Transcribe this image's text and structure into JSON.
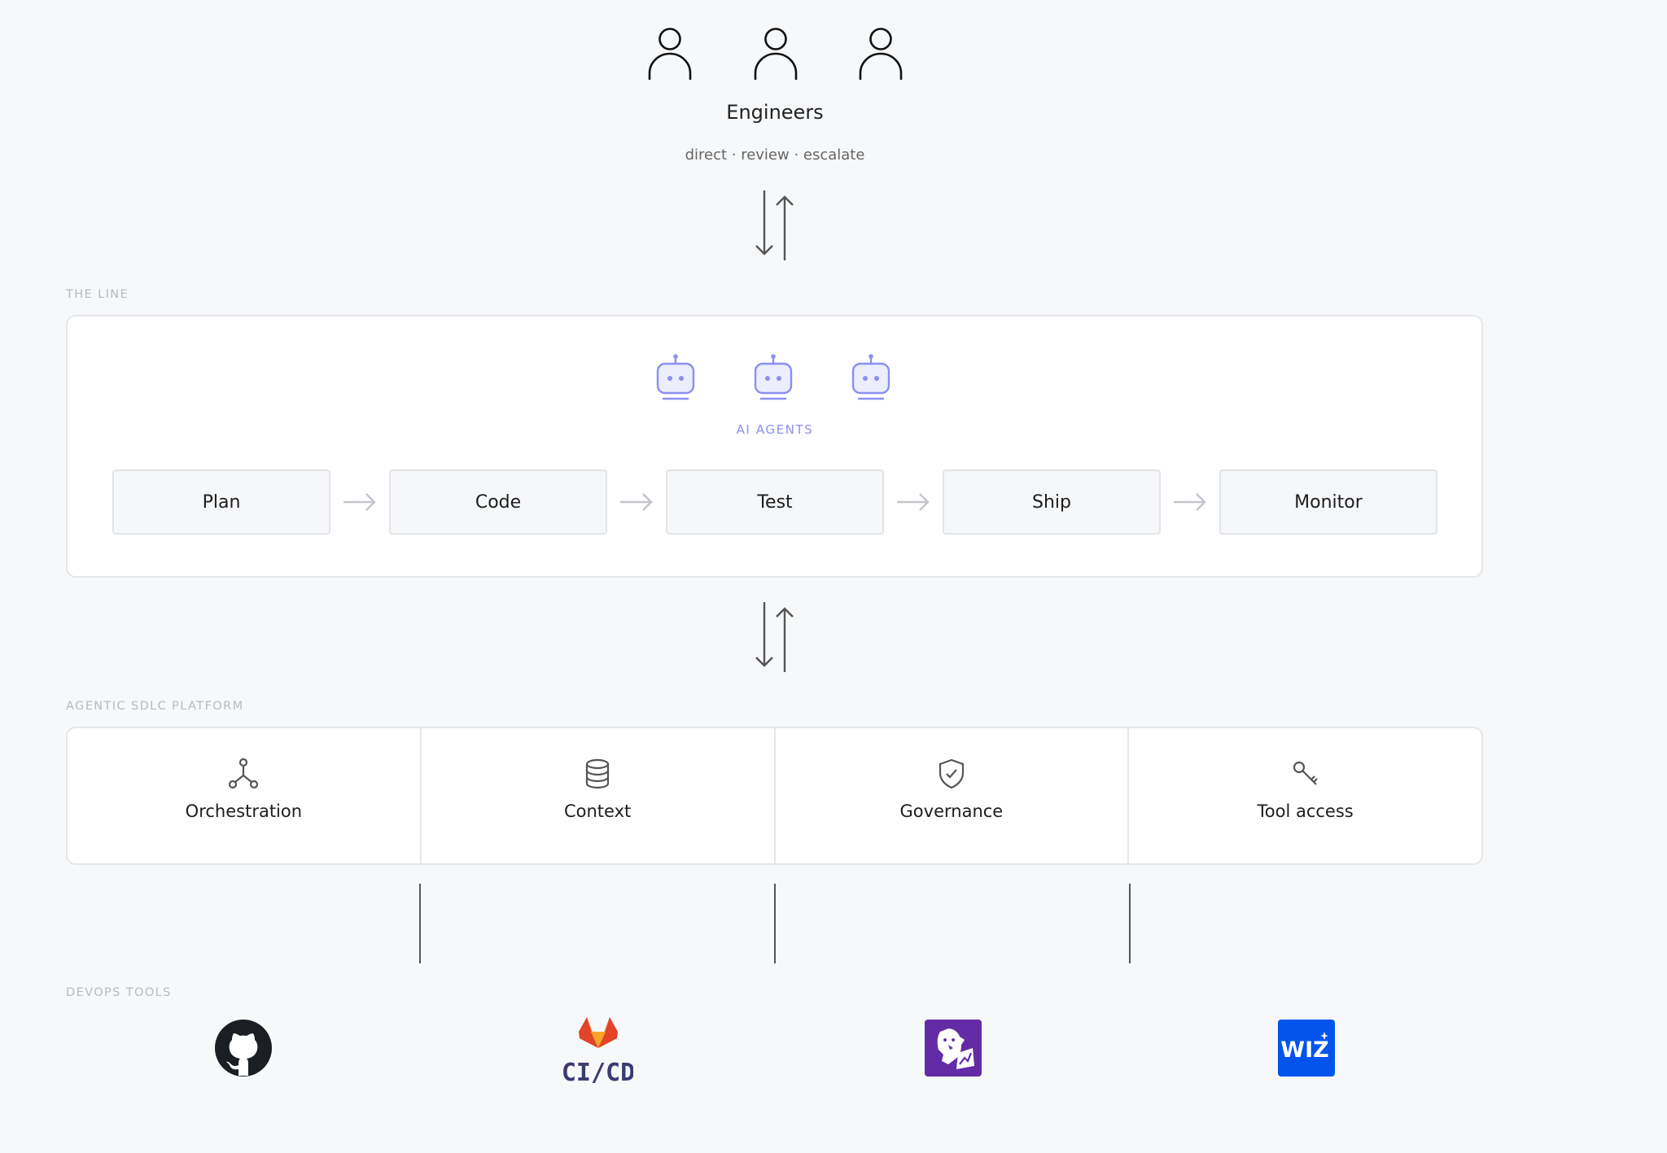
{
  "engineers": {
    "title": "Engineers",
    "subtitle": "direct · review · escalate",
    "icons": [
      "person-icon",
      "person-icon",
      "person-icon"
    ]
  },
  "the_line": {
    "section_label": "THE LINE",
    "agents_label": "AI AGENTS",
    "agent_icons": [
      "robot-icon",
      "robot-icon",
      "robot-icon"
    ],
    "stages": [
      "Plan",
      "Code",
      "Test",
      "Ship",
      "Monitor"
    ]
  },
  "platform": {
    "section_label": "AGENTIC SDLC PLATFORM",
    "items": [
      {
        "label": "Orchestration",
        "icon": "fork-nodes-icon"
      },
      {
        "label": "Context",
        "icon": "database-icon"
      },
      {
        "label": "Governance",
        "icon": "shield-check-icon"
      },
      {
        "label": "Tool access",
        "icon": "key-icon"
      }
    ]
  },
  "devops_tools": {
    "section_label": "DEVOPS TOOLS",
    "tools": [
      {
        "icon": "github-logo-icon"
      },
      {
        "icon": "gitlab-cicd-logo-icon",
        "text": "CI/CD"
      },
      {
        "icon": "datadog-logo-icon"
      },
      {
        "icon": "wiz-logo-icon",
        "text": "WIZ"
      }
    ]
  },
  "colors": {
    "background": "#f7f8fa",
    "agent_accent": "#8b8ff0",
    "card_border": "#e4e6ea",
    "datadog": "#632ca6",
    "wiz": "#0254ec",
    "gitlab": "#e24329"
  }
}
